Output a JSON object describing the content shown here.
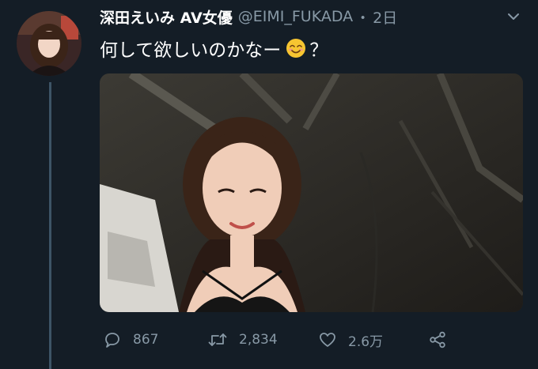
{
  "tweet": {
    "display_name": "深田えいみ AV女優",
    "handle": "@EIMI_FUKADA",
    "separator": "・",
    "time": "2日",
    "text_before_emoji": "何して欲しいのかなー",
    "emoji": "smiling-face-emoji",
    "text_after_emoji": "？"
  },
  "actions": {
    "reply_count": "867",
    "retweet_count": "2,834",
    "like_count": "2.6万"
  },
  "icons": {
    "caret": "chevron-down-icon",
    "reply": "reply-icon",
    "retweet": "retweet-icon",
    "like": "heart-icon",
    "share": "share-icon"
  },
  "colors": {
    "background": "#141d26",
    "text_primary": "#ffffff",
    "text_secondary": "#8899a6",
    "thread_line": "#3d5466"
  }
}
